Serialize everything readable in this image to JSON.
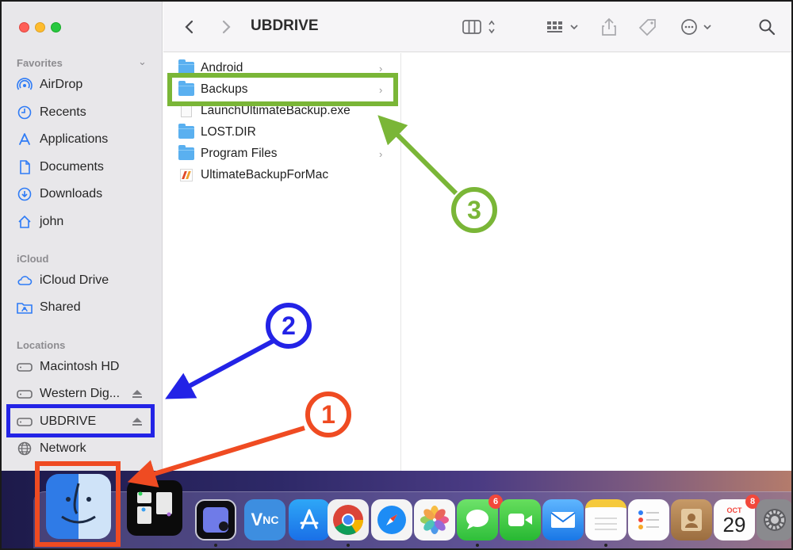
{
  "window": {
    "title": "UBDRIVE"
  },
  "sidebar": {
    "favorites_title": "Favorites",
    "favorites": [
      {
        "label": "AirDrop",
        "icon": "airdrop-icon"
      },
      {
        "label": "Recents",
        "icon": "clock-icon"
      },
      {
        "label": "Applications",
        "icon": "applications-icon"
      },
      {
        "label": "Documents",
        "icon": "document-icon"
      },
      {
        "label": "Downloads",
        "icon": "download-icon"
      },
      {
        "label": "john",
        "icon": "home-icon"
      }
    ],
    "icloud_title": "iCloud",
    "icloud": [
      {
        "label": "iCloud Drive",
        "icon": "cloud-icon"
      },
      {
        "label": "Shared",
        "icon": "shared-folder-icon"
      }
    ],
    "locations_title": "Locations",
    "locations": [
      {
        "label": "Macintosh HD",
        "icon": "disk-icon"
      },
      {
        "label": "Western Dig...",
        "icon": "disk-icon",
        "eject": true
      },
      {
        "label": "UBDRIVE",
        "icon": "disk-icon",
        "eject": true,
        "selected": true
      },
      {
        "label": "Network",
        "icon": "globe-icon"
      }
    ]
  },
  "files": [
    {
      "name": "Android",
      "type": "folder",
      "chevron": true
    },
    {
      "name": "Backups",
      "type": "folder",
      "chevron": true
    },
    {
      "name": "LaunchUltimateBackup.exe",
      "type": "file",
      "chevron": false
    },
    {
      "name": "LOST.DIR",
      "type": "folder",
      "chevron": false
    },
    {
      "name": "Program Files",
      "type": "folder",
      "chevron": true
    },
    {
      "name": "UltimateBackupForMac",
      "type": "app",
      "chevron": false
    }
  ],
  "chevron_glyph": "›",
  "annotations": {
    "step1": "1",
    "step2": "2",
    "step3": "3",
    "colors": {
      "step1": "#ef4b22",
      "step2": "#2323e6",
      "step3": "#7ab637"
    }
  },
  "dock": {
    "messages_badge": "6",
    "calendar_badge": "8",
    "calendar_month": "OCT",
    "calendar_day": "29"
  }
}
